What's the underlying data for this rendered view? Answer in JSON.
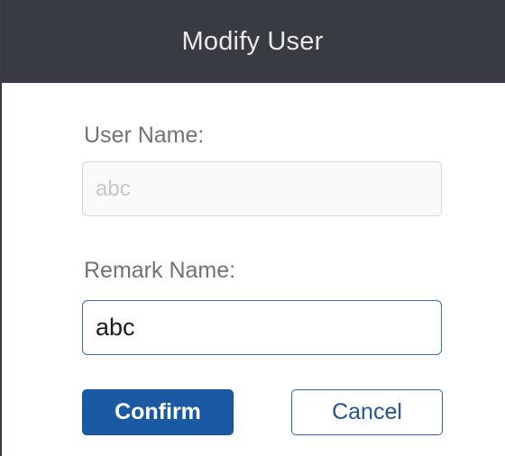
{
  "dialog": {
    "title": "Modify User"
  },
  "form": {
    "user_name": {
      "label": "User Name:",
      "value": "abc",
      "disabled": true
    },
    "remark_name": {
      "label": "Remark Name:",
      "value": "abc"
    }
  },
  "actions": {
    "confirm_label": "Confirm",
    "cancel_label": "Cancel"
  },
  "colors": {
    "titlebar_bg": "#383b41",
    "primary": "#1a5aa5",
    "focus_border": "#3c6fb3"
  }
}
